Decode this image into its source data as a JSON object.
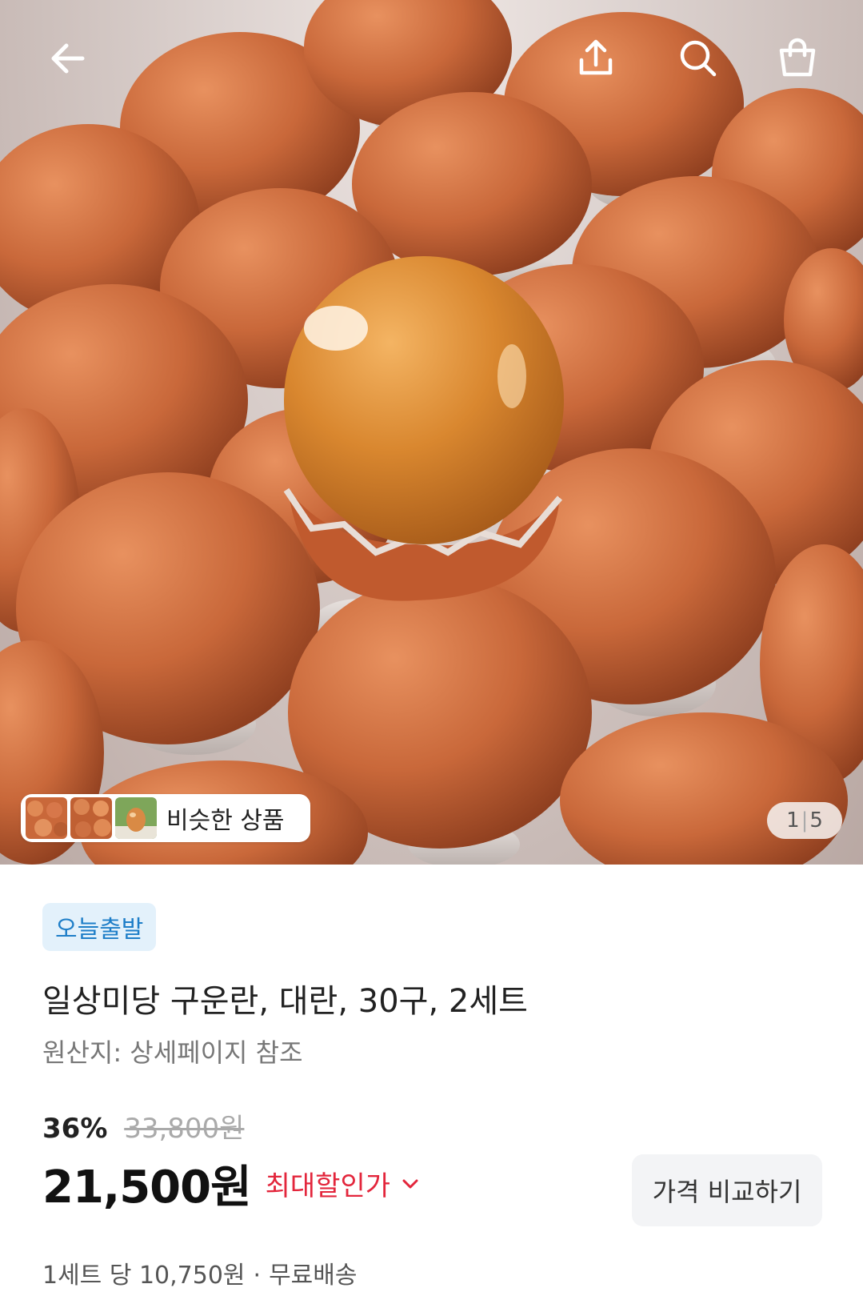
{
  "icons": {
    "back": "arrow-left-icon",
    "share": "share-upload-icon",
    "search": "search-icon",
    "cart": "shopping-bag-icon"
  },
  "gallery": {
    "similar_label": "비슷한 상품",
    "current": "1",
    "total": "5"
  },
  "product": {
    "badge": "오늘출발",
    "title": "일상미당 구운란, 대란, 30구, 2세트",
    "origin": "원산지: 상세페이지 참조",
    "discount_pct": "36%",
    "original_price": "33,800원",
    "price": "21,500원",
    "max_discount_label": "최대할인가",
    "compare_button": "가격 비교하기",
    "unit_price": "1세트 당 10,750원",
    "shipping": "무료배송",
    "separator": "·"
  },
  "colors": {
    "badge_bg": "#e3f1fb",
    "badge_text": "#1e7ec8",
    "sale_red": "#e3263c",
    "egg_brown": "#c9683a"
  }
}
